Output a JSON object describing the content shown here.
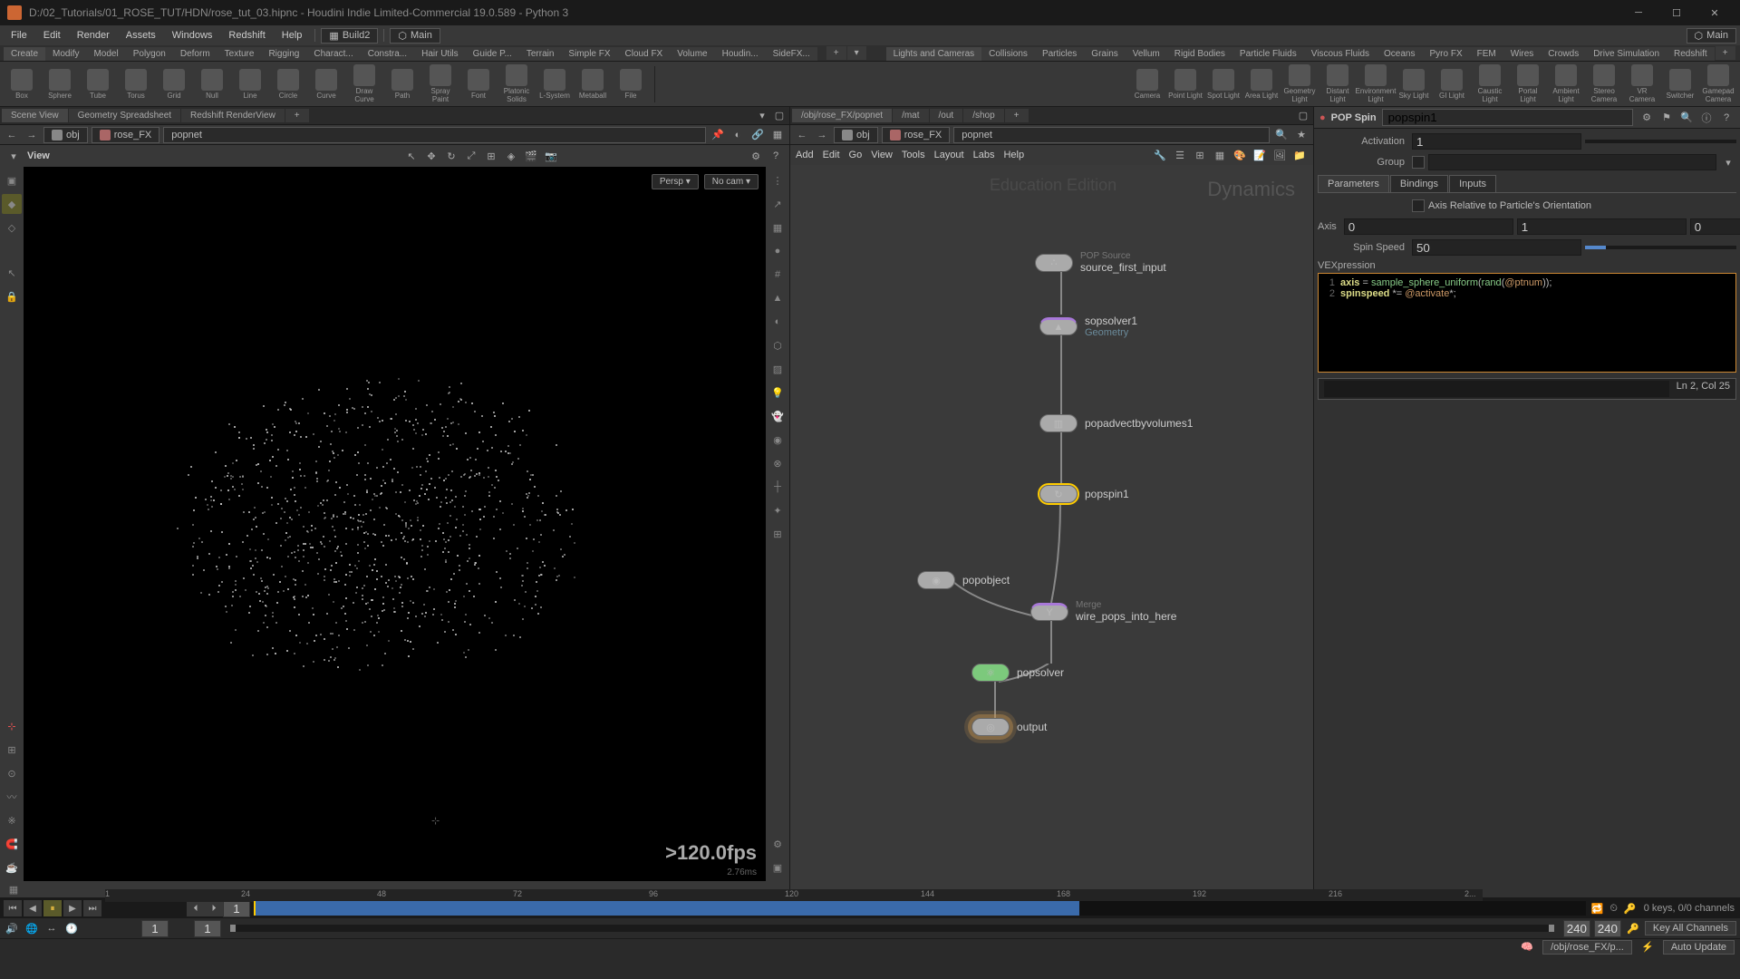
{
  "title": "D:/02_Tutorials/01_ROSE_TUT/HDN/rose_tut_03.hipnc - Houdini Indie Limited-Commercial 19.0.589 - Python 3",
  "menubar": [
    "File",
    "Edit",
    "Render",
    "Assets",
    "Windows",
    "Redshift",
    "Help"
  ],
  "desktop": "Build2",
  "main_context": "Main",
  "main_context_right": "Main",
  "shelf_tabs_left": [
    "Create",
    "Modify",
    "Model",
    "Polygon",
    "Deform",
    "Texture",
    "Rigging",
    "Charact...",
    "Constra...",
    "Hair Utils",
    "Guide P...",
    "Terrain",
    "Simple FX",
    "Cloud FX",
    "Volume",
    "Houdin...",
    "SideFX..."
  ],
  "shelf_tabs_right": [
    "Lights and Cameras",
    "Collisions",
    "Particles",
    "Grains",
    "Vellum",
    "Rigid Bodies",
    "Particle Fluids",
    "Viscous Fluids",
    "Oceans",
    "Pyro FX",
    "FEM",
    "Wires",
    "Crowds",
    "Drive Simulation",
    "Redshift"
  ],
  "shelf_tools_left": [
    "Box",
    "Sphere",
    "Tube",
    "Torus",
    "Grid",
    "Null",
    "Line",
    "Circle",
    "Curve",
    "Draw Curve",
    "Path",
    "Spray Paint",
    "Font",
    "Platonic Solids",
    "L-System",
    "Metaball",
    "File"
  ],
  "shelf_tools_right": [
    "Camera",
    "Point Light",
    "Spot Light",
    "Area Light",
    "Geometry Light",
    "Distant Light",
    "Environment Light",
    "Sky Light",
    "GI Light",
    "Caustic Light",
    "Portal Light",
    "Ambient Light",
    "Stereo Camera",
    "VR Camera",
    "Switcher",
    "Gamepad Camera"
  ],
  "left_pane_tabs": [
    "Scene View",
    "Geometry Spreadsheet",
    "Redshift RenderView"
  ],
  "path_left": [
    "obj",
    "rose_FX",
    "popnet"
  ],
  "right_pane_tabs": [
    "/obj/rose_FX/popnet",
    "/mat",
    "/out",
    "/shop"
  ],
  "path_right": [
    "obj",
    "rose_FX",
    "popnet"
  ],
  "view_label": "View",
  "viewport": {
    "persp": "Persp ▾",
    "cam": "No cam ▾",
    "fps": ">120.0fps",
    "time": "2.76ms",
    "edition": "Education Edition"
  },
  "network_menus": [
    "Add",
    "Edit",
    "Go",
    "View",
    "Tools",
    "Layout",
    "Labs",
    "Help"
  ],
  "net_watermark1": "Education Edition",
  "net_watermark2": "Dynamics",
  "nodes": {
    "source": {
      "label": "source_first_input",
      "type": "POP Source"
    },
    "sopsolver": {
      "label": "sopsolver1",
      "sub": "Geometry"
    },
    "advect": {
      "label": "popadvectbyvolumes1"
    },
    "popspin": {
      "label": "popspin1"
    },
    "popobject": {
      "label": "popobject"
    },
    "merge": {
      "label": "wire_pops_into_here",
      "type": "Merge"
    },
    "popsolver": {
      "label": "popsolver"
    },
    "output": {
      "label": "output"
    }
  },
  "param": {
    "nodetype": "POP Spin",
    "nodename": "popspin1",
    "activation_label": "Activation",
    "activation": "1",
    "group_label": "Group",
    "group": "",
    "tabs": [
      "Parameters",
      "Bindings",
      "Inputs"
    ],
    "axis_relative_label": "Axis Relative to Particle's Orientation",
    "axis_label": "Axis",
    "axis": [
      "0",
      "1",
      "0"
    ],
    "spinspeed_label": "Spin Speed",
    "spinspeed": "50",
    "vex_label": "VEXpression",
    "vex_lines": [
      {
        "n": "1",
        "text_parts": [
          {
            "t": "var",
            "v": "axis"
          },
          {
            "t": "txt",
            "v": " = "
          },
          {
            "t": "fn",
            "v": "sample_sphere_uniform"
          },
          {
            "t": "txt",
            "v": "("
          },
          {
            "t": "fn",
            "v": "rand"
          },
          {
            "t": "txt",
            "v": "("
          },
          {
            "t": "attr",
            "v": "@ptnum"
          },
          {
            "t": "txt",
            "v": "));"
          }
        ]
      },
      {
        "n": "2",
        "text_parts": [
          {
            "t": "var",
            "v": "spinspeed"
          },
          {
            "t": "txt",
            "v": " *= "
          },
          {
            "t": "attr",
            "v": "@activate"
          },
          {
            "t": "txt",
            "v": "*;"
          }
        ]
      }
    ],
    "vex_status": "Ln 2, Col 25"
  },
  "timeline": {
    "ticks": [
      "1",
      "24",
      "48",
      "72",
      "96",
      "120",
      "144",
      "168",
      "192",
      "216",
      "2..."
    ],
    "cur_frame": "1",
    "start": "1",
    "end1": "240",
    "end2": "240",
    "keys_info": "0 keys, 0/0 channels",
    "key_all": "Key All Channels",
    "path": "/obj/rose_FX/p...",
    "auto_update": "Auto Update"
  }
}
